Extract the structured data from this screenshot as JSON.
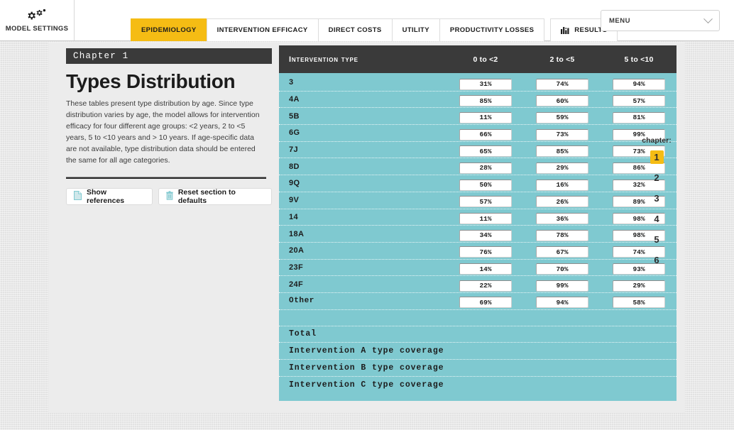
{
  "topbar": {
    "model_settings_label": "MODEL SETTINGS",
    "model_settings_icon": "gears-icon",
    "menu_select_value": "MENU",
    "menu_chevron_icon": "chevron-down-icon",
    "tabs": [
      {
        "label": "EPIDEMIOLOGY",
        "active": true,
        "icon": null
      },
      {
        "label": "INTERVENTION EFFICACY",
        "active": false,
        "icon": null
      },
      {
        "label": "DIRECT COSTS",
        "active": false,
        "icon": null
      },
      {
        "label": "UTILITY",
        "active": false,
        "icon": null
      },
      {
        "label": "PRODUCTIVITY LOSSES",
        "active": false,
        "icon": null
      },
      {
        "label": "RESULTS",
        "active": false,
        "icon": "bar-chart-icon"
      }
    ]
  },
  "sidebar": {
    "chapter_bar": "Chapter 1",
    "title": "Types Distribution",
    "description": "These tables present type distribution by age. Since type distribution varies by age, the model allows for intervention efficacy for four different age groups: <2 years, 2 to <5 years, 5 to <10 years and > 10 years. If age-specific data are not available, type distribution data should be entered the same for all age categories.",
    "show_references_label": "Show references",
    "show_references_icon": "document-icon",
    "reset_label": "Reset section to defaults",
    "reset_icon": "trash-icon"
  },
  "table": {
    "header_label": "Intervention type",
    "columns": [
      "0 to <2",
      "2 to <5",
      "5 to <10"
    ],
    "rows": [
      {
        "label": "3",
        "mono": false,
        "values": [
          "31%",
          "74%",
          "94%"
        ]
      },
      {
        "label": "4A",
        "mono": false,
        "values": [
          "85%",
          "60%",
          "57%"
        ]
      },
      {
        "label": "5B",
        "mono": false,
        "values": [
          "11%",
          "59%",
          "81%"
        ]
      },
      {
        "label": "6G",
        "mono": false,
        "values": [
          "66%",
          "73%",
          "99%"
        ]
      },
      {
        "label": "7J",
        "mono": false,
        "values": [
          "65%",
          "85%",
          "73%"
        ]
      },
      {
        "label": "8D",
        "mono": false,
        "values": [
          "28%",
          "29%",
          "86%"
        ]
      },
      {
        "label": "9Q",
        "mono": false,
        "values": [
          "50%",
          "16%",
          "32%"
        ]
      },
      {
        "label": "9V",
        "mono": false,
        "values": [
          "57%",
          "26%",
          "89%"
        ]
      },
      {
        "label": "14",
        "mono": false,
        "values": [
          "11%",
          "36%",
          "98%"
        ]
      },
      {
        "label": "18A",
        "mono": false,
        "values": [
          "34%",
          "78%",
          "98%"
        ]
      },
      {
        "label": "20A",
        "mono": false,
        "values": [
          "76%",
          "67%",
          "74%"
        ]
      },
      {
        "label": "23F",
        "mono": false,
        "values": [
          "14%",
          "70%",
          "93%"
        ]
      },
      {
        "label": "24F",
        "mono": false,
        "values": [
          "22%",
          "99%",
          "29%"
        ]
      },
      {
        "label": "Other",
        "mono": true,
        "values": [
          "69%",
          "94%",
          "58%"
        ]
      }
    ],
    "summary_rows": [
      "Total",
      "Intervention A type coverage",
      "Intervention B type coverage",
      "Intervention C type coverage"
    ]
  },
  "chapter_nav": {
    "title": "chapter:",
    "items": [
      "1",
      "2",
      "3",
      "4",
      "5",
      "6"
    ],
    "active_index": 0
  },
  "colors": {
    "accent": "#f5bc14",
    "table_teal": "#7fc9d0",
    "header_dark": "#3a3a3a",
    "panel_bg": "#ececec"
  }
}
